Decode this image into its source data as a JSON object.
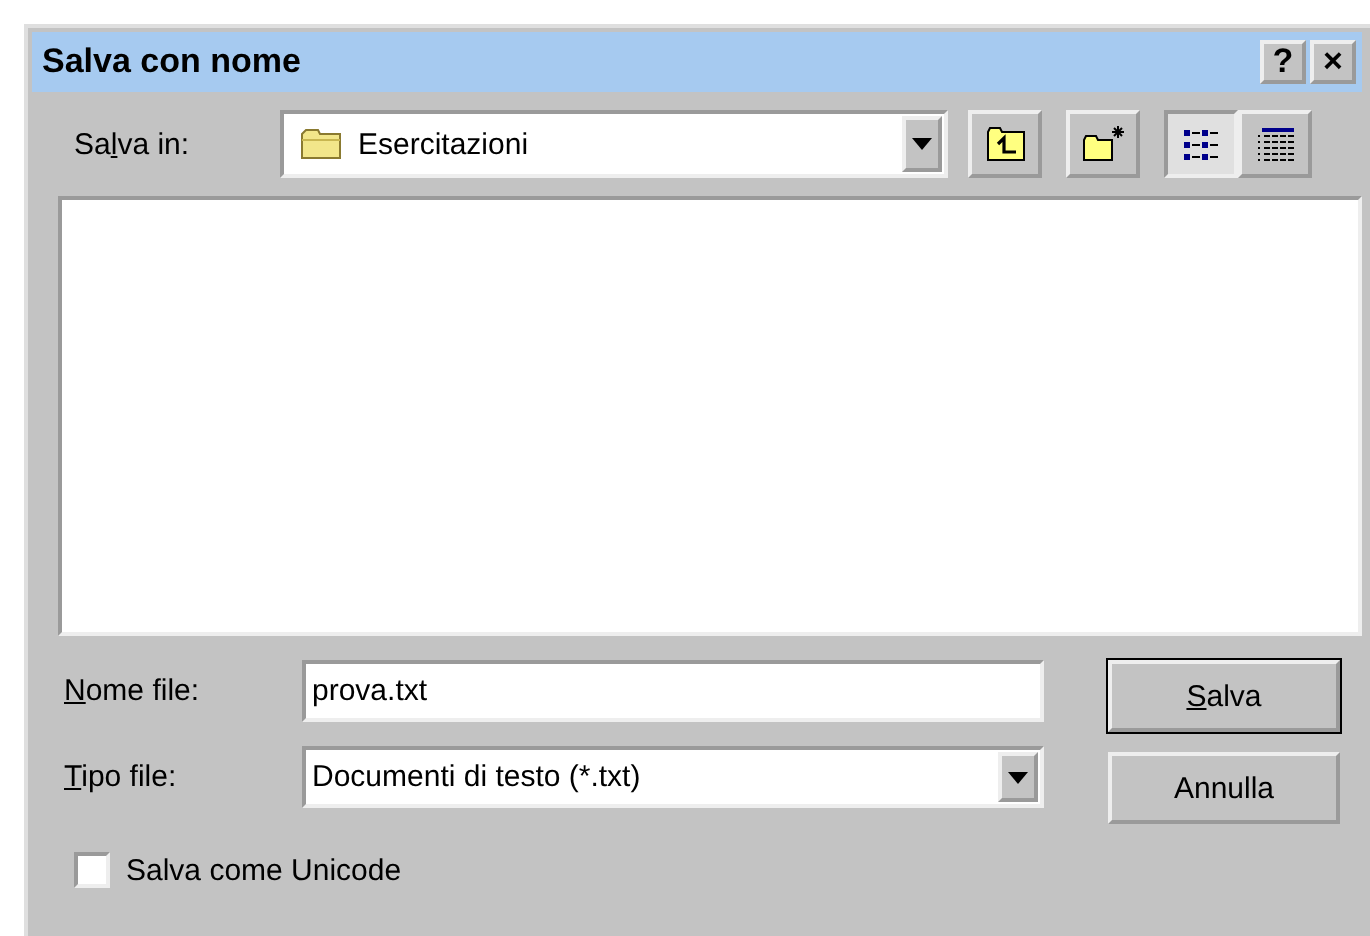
{
  "window": {
    "title": "Salva con nome",
    "title_buttons": [
      "?",
      "×"
    ]
  },
  "save_in": {
    "label_parts": {
      "pre": "Sa",
      "key": "l",
      "post": "va in:"
    },
    "value": "Esercitazioni"
  },
  "toolbar": [
    {
      "kind": "up",
      "selected": false
    },
    {
      "kind": "new-folder",
      "selected": false
    },
    {
      "kind": "list",
      "selected": true
    },
    {
      "kind": "details",
      "selected": false
    }
  ],
  "file_name": {
    "label_parts": {
      "key": "N",
      "post": "ome file:"
    },
    "value": "prova.txt"
  },
  "file_type": {
    "label_parts": {
      "key": "T",
      "post": "ipo file:"
    },
    "value": "Documenti di testo (*.txt)"
  },
  "buttons": [
    {
      "label_parts": {
        "key": "S",
        "post": "alva"
      },
      "default": true
    },
    {
      "label_parts": {
        "pre": "Annulla"
      },
      "default": false
    }
  ],
  "unicode": {
    "label": "Salva come Unicode",
    "checked": false
  }
}
